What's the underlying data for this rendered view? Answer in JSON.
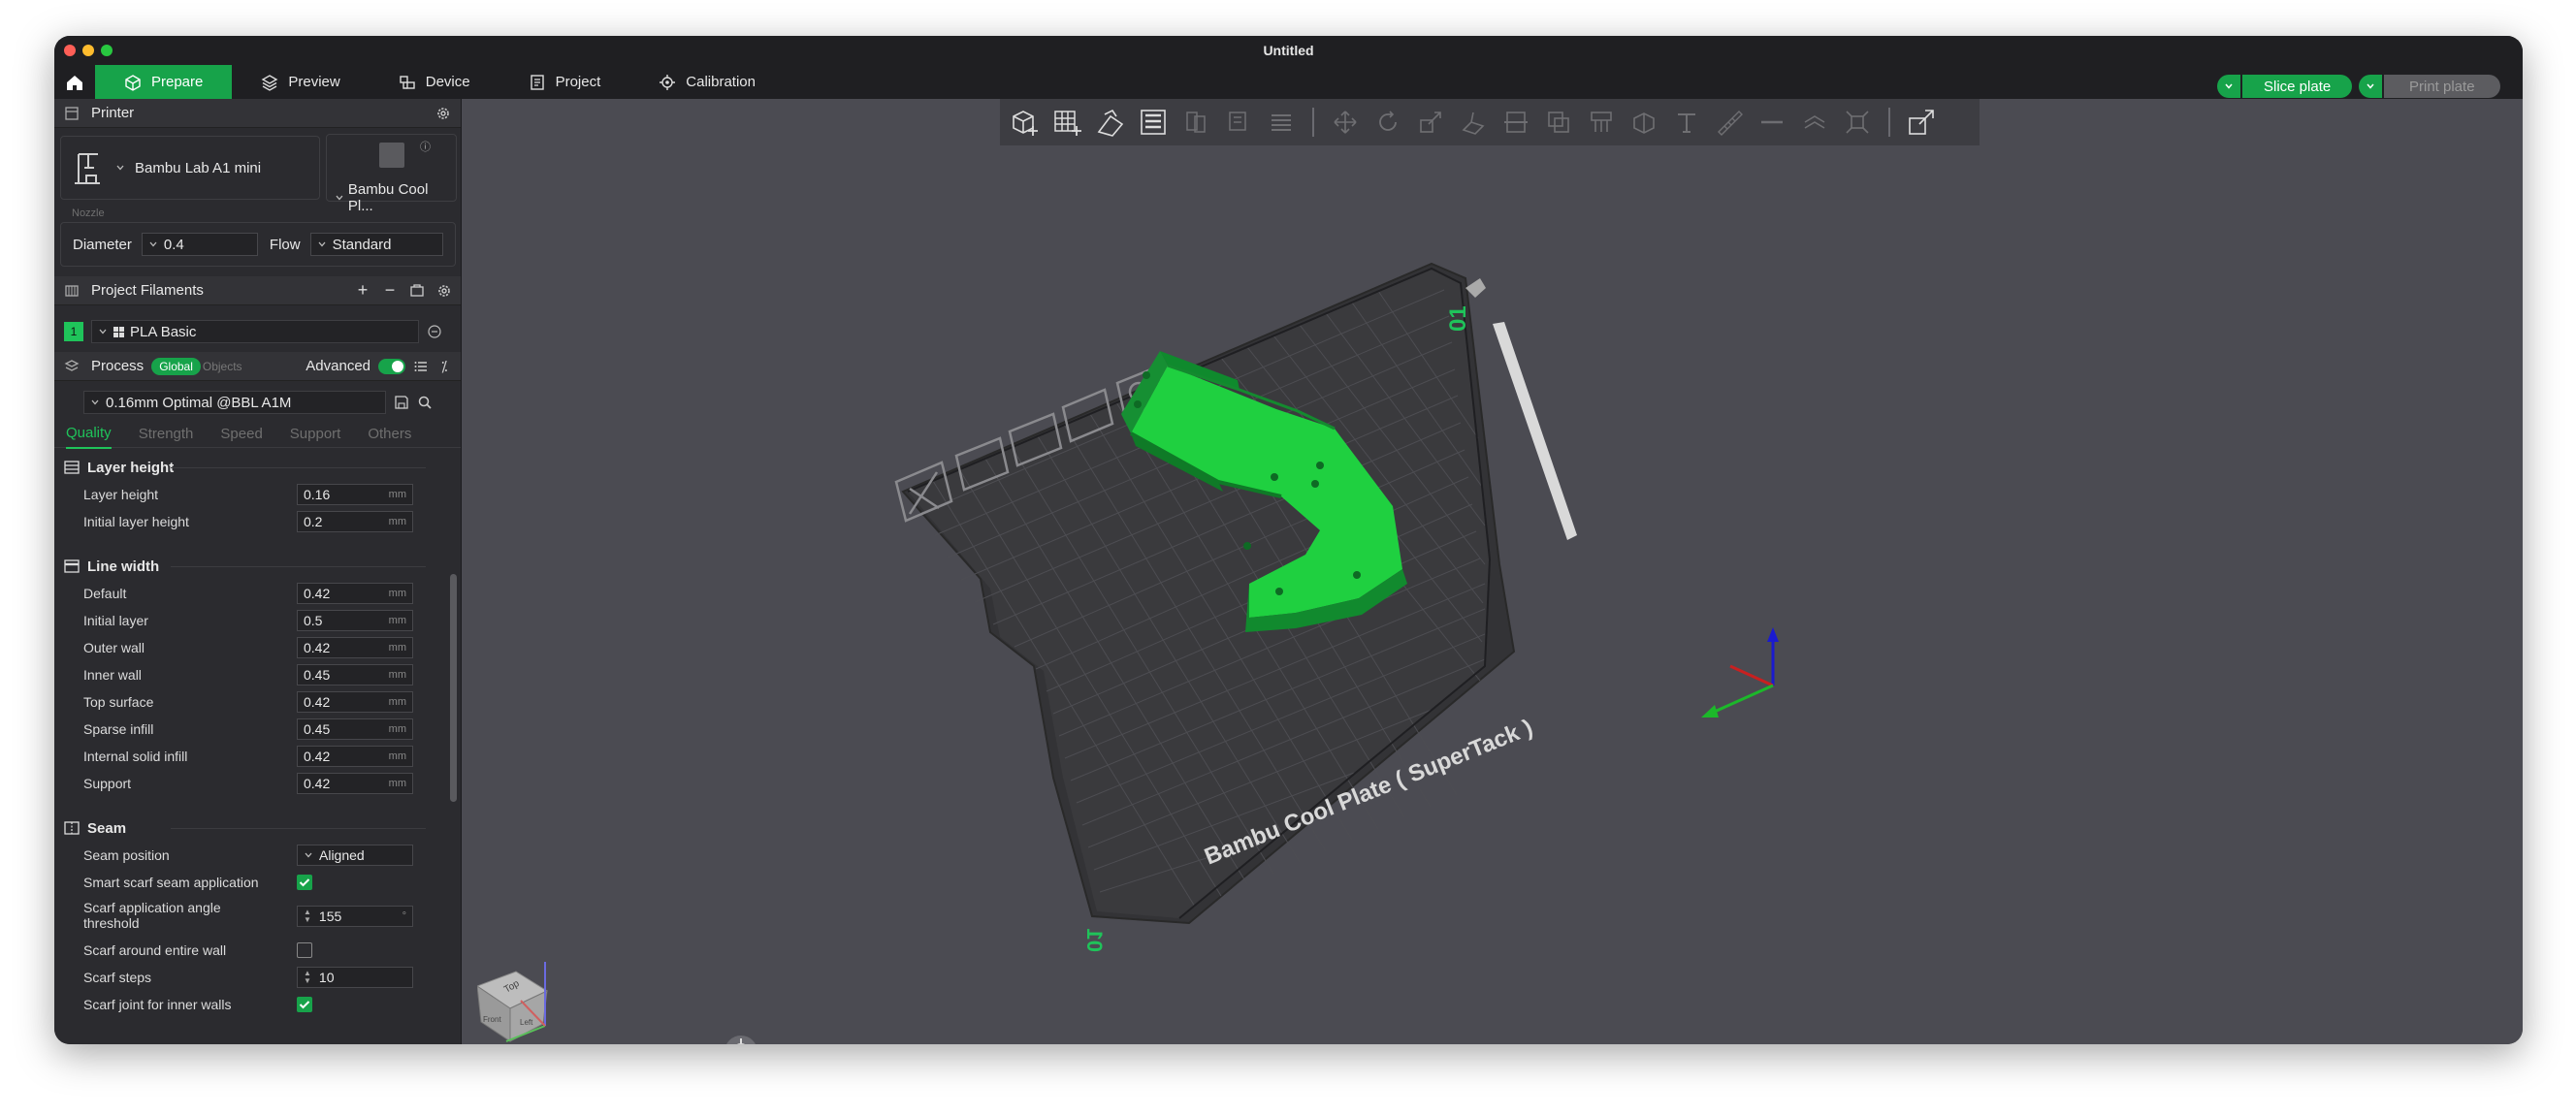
{
  "window": {
    "title": "Untitled"
  },
  "tabs": [
    {
      "label": "Prepare",
      "icon": "cube-icon",
      "active": true
    },
    {
      "label": "Preview",
      "icon": "layers-icon"
    },
    {
      "label": "Device",
      "icon": "device-icon"
    },
    {
      "label": "Project",
      "icon": "project-icon"
    },
    {
      "label": "Calibration",
      "icon": "calibration-icon"
    }
  ],
  "actions": {
    "slice_label": "Slice plate",
    "print_label": "Print plate"
  },
  "printer": {
    "section_title": "Printer",
    "name": "Bambu Lab A1 mini",
    "plate": "Bambu Cool Pl...",
    "nozzle_label": "Nozzle",
    "diameter_label": "Diameter",
    "diameter_value": "0.4",
    "flow_label": "Flow",
    "flow_value": "Standard"
  },
  "filaments": {
    "section_title": "Project Filaments",
    "items": [
      {
        "index": "1",
        "name": "PLA Basic",
        "color": "#1fc35a"
      }
    ]
  },
  "process": {
    "section_title": "Process",
    "global_label": "Global",
    "objects_label": "Objects",
    "advanced_label": "Advanced",
    "preset": "0.16mm Optimal @BBL A1M",
    "subtabs": [
      "Quality",
      "Strength",
      "Speed",
      "Support",
      "Others"
    ]
  },
  "groups": {
    "layer_height": {
      "title": "Layer height",
      "rows": [
        {
          "label": "Layer height",
          "value": "0.16",
          "unit": "mm"
        },
        {
          "label": "Initial layer height",
          "value": "0.2",
          "unit": "mm"
        }
      ]
    },
    "line_width": {
      "title": "Line width",
      "rows": [
        {
          "label": "Default",
          "value": "0.42",
          "unit": "mm"
        },
        {
          "label": "Initial layer",
          "value": "0.5",
          "unit": "mm"
        },
        {
          "label": "Outer wall",
          "value": "0.42",
          "unit": "mm"
        },
        {
          "label": "Inner wall",
          "value": "0.45",
          "unit": "mm"
        },
        {
          "label": "Top surface",
          "value": "0.42",
          "unit": "mm"
        },
        {
          "label": "Sparse infill",
          "value": "0.45",
          "unit": "mm"
        },
        {
          "label": "Internal solid infill",
          "value": "0.42",
          "unit": "mm"
        },
        {
          "label": "Support",
          "value": "0.42",
          "unit": "mm"
        }
      ]
    },
    "seam": {
      "title": "Seam",
      "seam_position_label": "Seam position",
      "seam_position_value": "Aligned",
      "smart_scarf_label": "Smart scarf seam application",
      "scarf_angle_label_1": "Scarf application angle",
      "scarf_angle_label_2": "threshold",
      "scarf_angle_value": "155",
      "scarf_angle_unit": "°",
      "scarf_entire_label": "Scarf around entire wall",
      "scarf_steps_label": "Scarf steps",
      "scarf_steps_value": "10",
      "scarf_inner_label": "Scarf joint for inner walls"
    }
  },
  "viewport": {
    "plate_label": "Bambu Cool Plate ( SuperTack )",
    "plate_number": "01",
    "accent": "#1fc35a",
    "cube_labels": {
      "top": "Top",
      "left": "Front",
      "right": "Left"
    }
  }
}
